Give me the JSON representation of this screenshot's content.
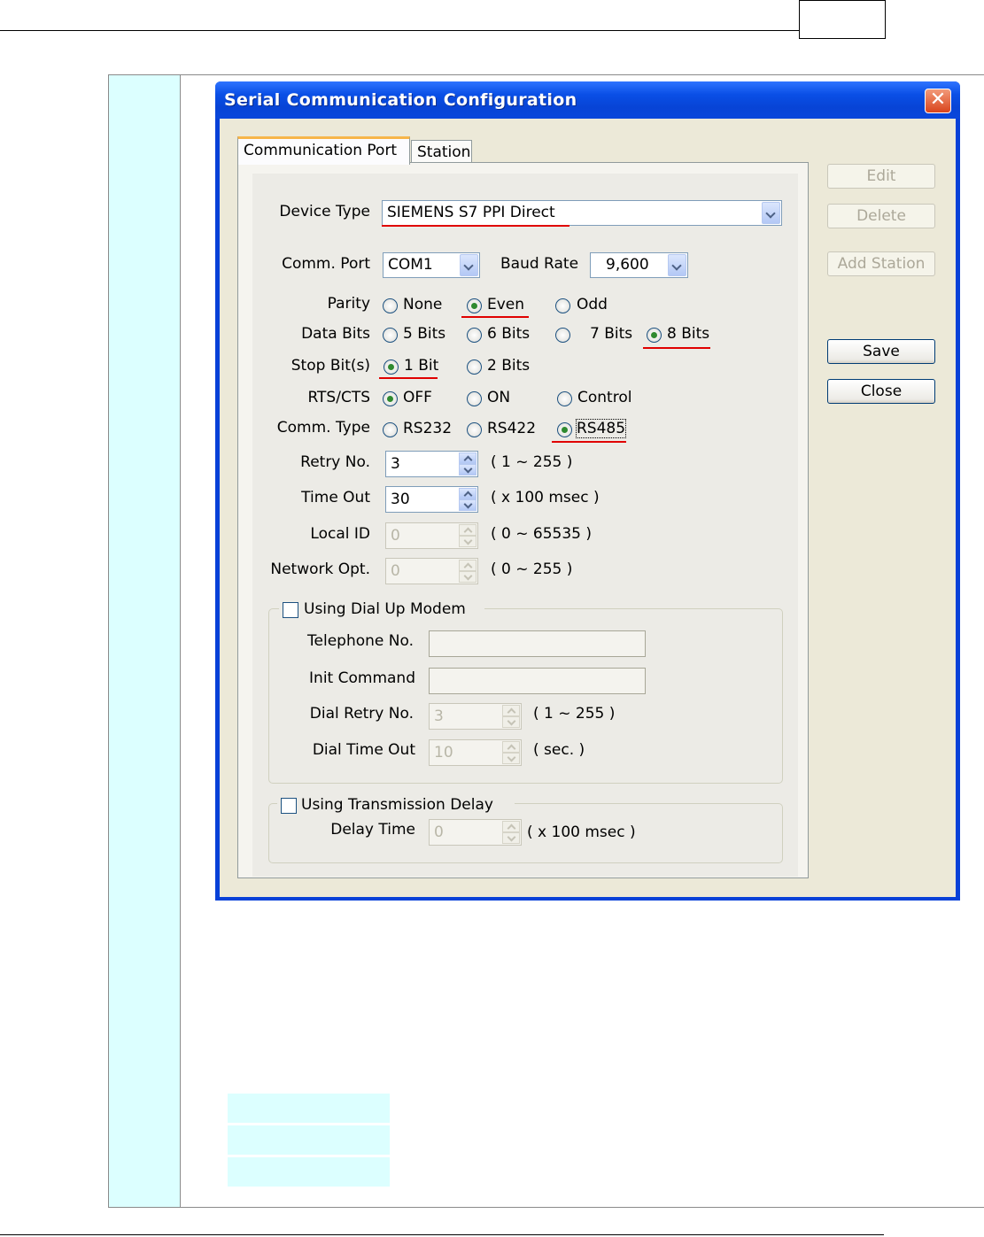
{
  "dialog": {
    "title": "Serial Communication Configuration",
    "close_glyph": "✕",
    "tabs": [
      "Communication Port",
      "Station"
    ],
    "side_buttons": {
      "edit": "Edit",
      "delete": "Delete",
      "add_station": "Add Station",
      "save": "Save",
      "close": "Close"
    },
    "fields": {
      "device_type": {
        "label": "Device Type",
        "value": "SIEMENS S7 PPI Direct"
      },
      "comm_port": {
        "label": "Comm. Port",
        "value": "COM1"
      },
      "baud_rate": {
        "label": "Baud Rate",
        "value": "9,600"
      },
      "parity": {
        "label": "Parity",
        "options": [
          "None",
          "Even",
          "Odd"
        ],
        "selected": "Even"
      },
      "data_bits": {
        "label": "Data Bits",
        "options": [
          "5 Bits",
          "6 Bits",
          "7 Bits",
          "8 Bits"
        ],
        "selected": "8 Bits"
      },
      "stop_bits": {
        "label": "Stop Bit(s)",
        "options": [
          "1 Bit",
          "2 Bits"
        ],
        "selected": "1 Bit"
      },
      "rts_cts": {
        "label": "RTS/CTS",
        "options": [
          "OFF",
          "ON",
          "Control"
        ],
        "selected": "OFF"
      },
      "comm_type": {
        "label": "Comm. Type",
        "options": [
          "RS232",
          "RS422",
          "RS485"
        ],
        "selected": "RS485"
      },
      "retry_no": {
        "label": "Retry No.",
        "value": "3",
        "range": "( 1 ~ 255 )"
      },
      "time_out": {
        "label": "Time Out",
        "value": "30",
        "range": "( x 100 msec )"
      },
      "local_id": {
        "label": "Local ID",
        "value": "0",
        "range": "( 0 ~ 65535 )"
      },
      "network_opt": {
        "label": "Network Opt.",
        "value": "0",
        "range": "( 0 ~ 255 )"
      }
    },
    "dial_up": {
      "label": "Using Dial Up Modem",
      "checked": false,
      "telephone_label": "Telephone No.",
      "telephone_value": "",
      "init_label": "Init Command",
      "init_value": "",
      "dial_retry_label": "Dial Retry No.",
      "dial_retry_value": "3",
      "dial_retry_range": "( 1 ~ 255 )",
      "dial_timeout_label": "Dial Time Out",
      "dial_timeout_value": "10",
      "dial_timeout_range": "( sec. )"
    },
    "transmission_delay": {
      "label": "Using Transmission Delay",
      "checked": false,
      "delay_label": "Delay Time",
      "delay_value": "0",
      "delay_range": "( x 100 msec )"
    }
  },
  "colors": {
    "title_bar": "#0a4fe6",
    "client": "#ece9d8",
    "annotation": "#e00000",
    "side_column": "#dcffff"
  }
}
